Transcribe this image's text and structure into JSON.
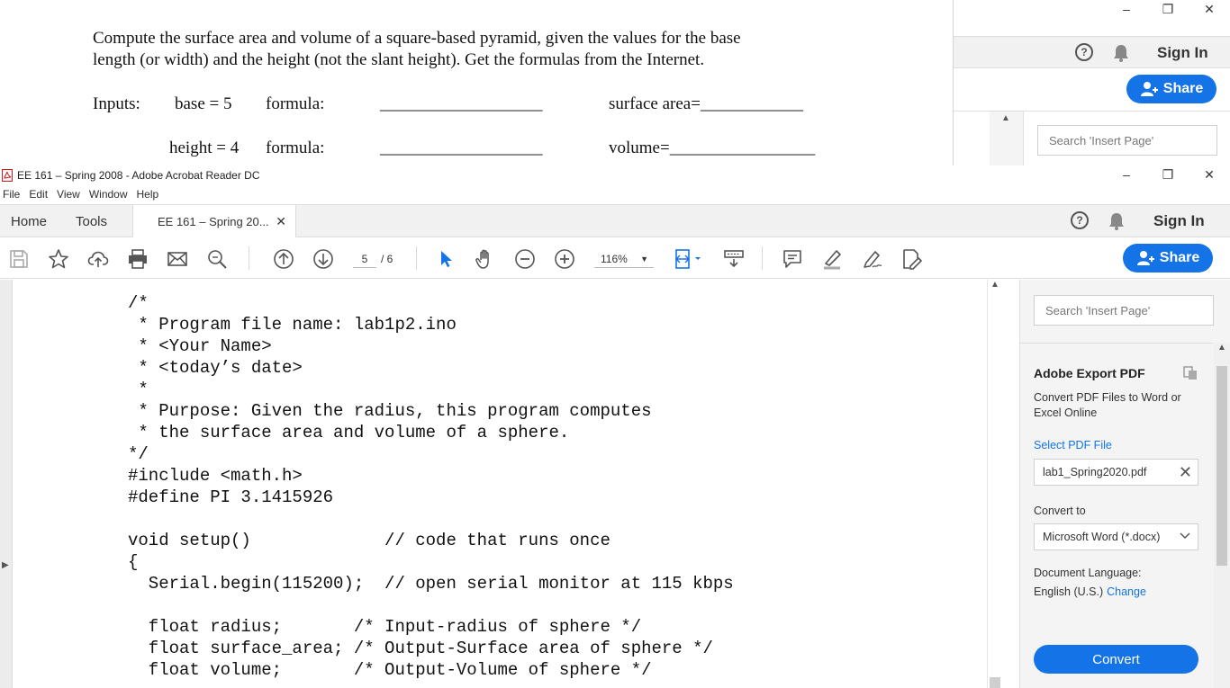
{
  "bg_window": {
    "doc_lines": [
      "Compute the surface area and volume of a square-based pyramid, given the values for the base",
      "length (or width) and the height (not the slant height). Get the formulas from the Internet.",
      "Inputs:",
      "base = 5",
      "formula:",
      "___________________",
      "surface area=____________",
      "height = 4",
      "formula:",
      "___________________",
      "volume=_________________"
    ],
    "sign_in": "Sign In",
    "share": "Share",
    "search_placeholder": "Search 'Insert Page'"
  },
  "window": {
    "title": "EE 161 – Spring 2008 - Adobe Acrobat Reader DC",
    "controls": {
      "minimize": "–",
      "restore": "❐",
      "close": "✕"
    }
  },
  "menu": [
    "File",
    "Edit",
    "View",
    "Window",
    "Help"
  ],
  "tabs": {
    "home": "Home",
    "tools": "Tools",
    "document": "EE 161 – Spring 20...",
    "close": "✕"
  },
  "header": {
    "help": "?",
    "sign_in": "Sign In",
    "share": "Share"
  },
  "toolbar": {
    "page_current": "5",
    "page_total": "/ 6",
    "zoom": "116%",
    "zoom_caret": "▼"
  },
  "document": {
    "code_lines": [
      "/*",
      " * Program file name: lab1p2.ino",
      " * <Your Name>",
      " * <today’s date>",
      " *",
      " * Purpose: Given the radius, this program computes",
      " * the surface area and volume of a sphere.",
      "*/",
      "#include <math.h>",
      "#define PI 3.1415926",
      "",
      "void setup()             // code that runs once",
      "{",
      "  Serial.begin(115200);  // open serial monitor at 115 kbps",
      "",
      "  float radius;       /* Input-radius of sphere */",
      "  float surface_area; /* Output-Surface area of sphere */",
      "  float volume;       /* Output-Volume of sphere */"
    ]
  },
  "right_pane": {
    "search_placeholder": "Search 'Insert Page'",
    "title": "Adobe Export PDF",
    "description": "Convert PDF Files to Word or Excel Online",
    "select_file": "Select PDF File",
    "file_name": "lab1_Spring2020.pdf",
    "file_remove": "✕",
    "convert_to_label": "Convert to",
    "format": "Microsoft Word (*.docx)",
    "language_label": "Document Language:",
    "language": "English (U.S.)",
    "language_change": "Change",
    "convert_button": "Convert"
  },
  "colors": {
    "accent": "#1473e6",
    "tab_bar": "#f1f1f1",
    "pane_bg": "#f4f4f4"
  },
  "icons": [
    "save-icon",
    "bookmark-star-icon",
    "upload-cloud-icon",
    "print-icon",
    "email-icon",
    "find-icon",
    "previous-page-icon",
    "next-page-icon",
    "select-cursor-icon",
    "hand-tool-icon",
    "zoom-out-icon",
    "zoom-in-icon",
    "fit-page-icon",
    "read-mode-icon",
    "comment-icon",
    "highlight-icon",
    "sign-icon",
    "edit-icon",
    "help-icon",
    "bell-icon",
    "add-user-icon"
  ]
}
